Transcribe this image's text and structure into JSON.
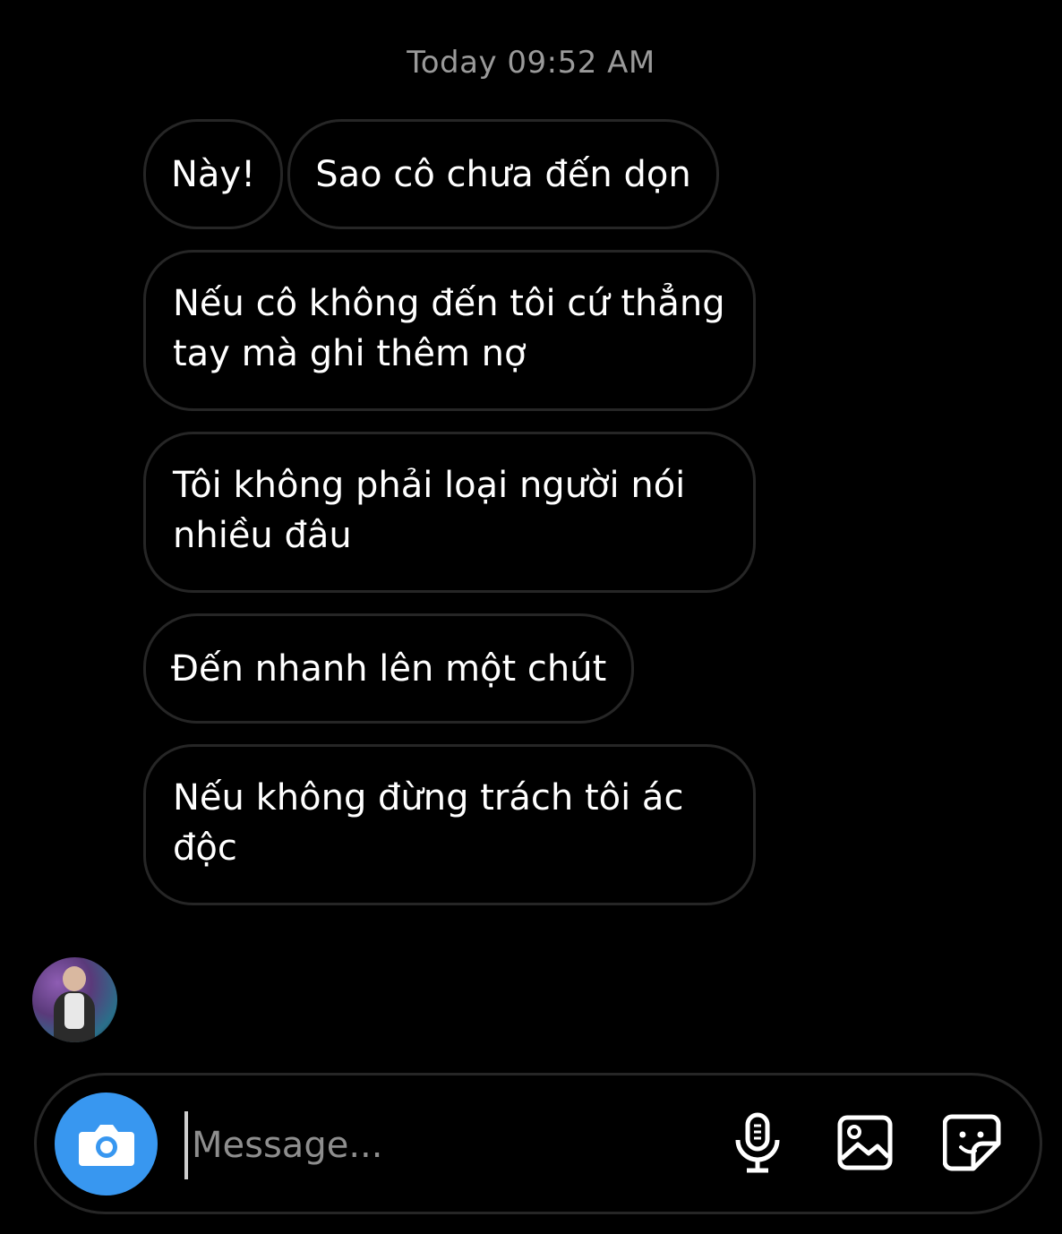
{
  "thread": {
    "timestamp": "Today 09:52 AM",
    "messages": [
      "Này!",
      "Sao cô chưa đến dọn",
      "Nếu cô không đến tôi cứ thẳng tay mà ghi thêm nợ",
      "Tôi không phải loại người nói nhiều đâu",
      "Đến nhanh lên một chút",
      "Nếu không đừng trách tôi ác độc"
    ]
  },
  "composer": {
    "placeholder": "Message...",
    "camera_icon": "camera-icon",
    "mic_icon": "microphone-icon",
    "gallery_icon": "image-icon",
    "sticker_icon": "sticker-icon"
  },
  "colors": {
    "background": "#000000",
    "bubble_border": "#262626",
    "accent": "#3897f0",
    "timestamp": "#9a9a9a"
  }
}
